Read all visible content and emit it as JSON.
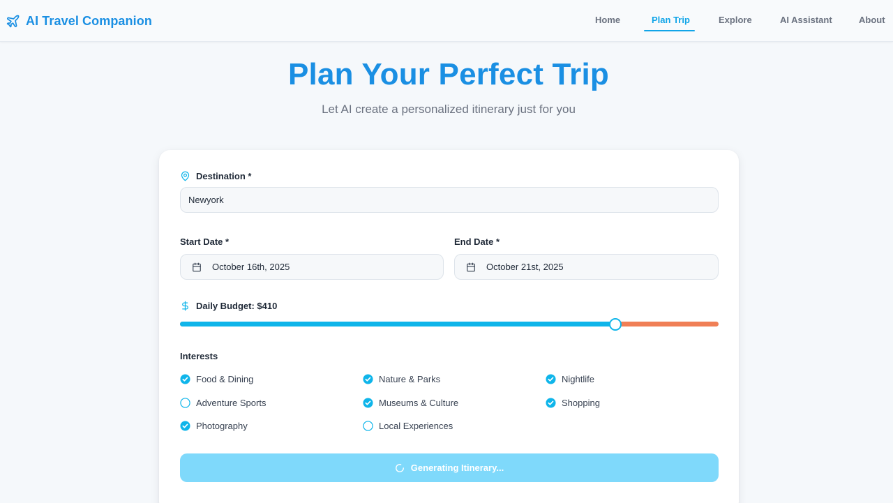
{
  "app": {
    "name": "AI Travel Companion"
  },
  "nav": {
    "items": [
      {
        "label": "Home"
      },
      {
        "label": "Plan Trip",
        "active": true
      },
      {
        "label": "Explore"
      },
      {
        "label": "AI Assistant"
      },
      {
        "label": "About"
      }
    ]
  },
  "hero": {
    "title": "Plan Your Perfect Trip",
    "subtitle": "Let AI create a personalized itinerary just for you"
  },
  "form": {
    "destination": {
      "label": "Destination *",
      "value": "Newyork",
      "icon": "map-pin-icon"
    },
    "start_date": {
      "label": "Start Date *",
      "value": "October 16th, 2025",
      "icon": "calendar-icon"
    },
    "end_date": {
      "label": "End Date *",
      "value": "October 21st, 2025",
      "icon": "calendar-icon"
    },
    "budget": {
      "label": "Daily Budget: $410",
      "value_fraction": 0.808,
      "icon": "dollar-icon"
    },
    "interests": {
      "label": "Interests",
      "items": [
        {
          "label": "Food & Dining",
          "checked": true
        },
        {
          "label": "Nature & Parks",
          "checked": true
        },
        {
          "label": "Nightlife",
          "checked": true
        },
        {
          "label": "Adventure Sports",
          "checked": false
        },
        {
          "label": "Museums & Culture",
          "checked": true
        },
        {
          "label": "Shopping",
          "checked": true
        },
        {
          "label": "Photography",
          "checked": true
        },
        {
          "label": "Local Experiences",
          "checked": false
        }
      ]
    },
    "submit": {
      "label": "Generating Itinerary...",
      "state": "loading"
    }
  },
  "colors": {
    "brand": "#1a8fe3",
    "accent": "#0fb5ea",
    "slider_rest": "#f07f56",
    "button_loading": "#7fd9fb"
  }
}
